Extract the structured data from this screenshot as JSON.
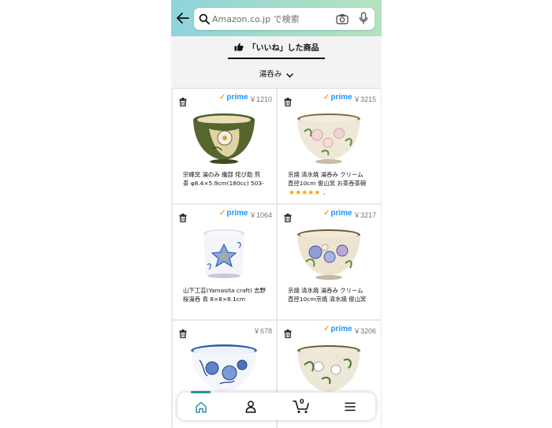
{
  "search": {
    "placeholder": "Amazon.co.jp で検索"
  },
  "tab": {
    "label": "「いいね」した商品"
  },
  "filter": {
    "label": "湯呑み"
  },
  "prime_label": "prime",
  "products": [
    {
      "prime": true,
      "price": "￥1210",
      "title_lines": [
        "宗峰窯 湯のみ 織部 侘び助 煎",
        "茶 φ8.4×5.9cm(180cc) 503-"
      ],
      "rating": null
    },
    {
      "prime": true,
      "price": "￥3215",
      "title_lines": [
        "京焼 清水焼 湯呑み クリーム",
        "直径10cm 俊山窯 お茶呑茶碗"
      ],
      "rating": 5
    },
    {
      "prime": true,
      "price": "￥1064",
      "title_lines": [
        "山下工芸(Yamasita craft) 志野",
        "桜湯呑 青 8×8×8.1cm"
      ],
      "rating": null
    },
    {
      "prime": true,
      "price": "￥3217",
      "title_lines": [
        "京焼 清水焼 湯呑み クリーム",
        "直径10cm京焼 清水焼 俊山窯"
      ],
      "rating": null
    },
    {
      "prime": false,
      "price": "￥678",
      "title_lines": [],
      "rating": null
    },
    {
      "prime": true,
      "price": "￥3206",
      "title_lines": [],
      "rating": null
    }
  ],
  "rating_display": "★★★★★",
  "cart": {
    "count": "0"
  },
  "colors": {
    "prime_blue": "#1a98ff",
    "accent_teal": "#2a8fa0",
    "star": "#f6a400"
  },
  "icons": [
    "back-arrow-icon",
    "search-icon",
    "camera-icon",
    "mic-icon",
    "thumbs-up-icon",
    "chevron-down-icon",
    "trash-icon",
    "home-icon",
    "account-icon",
    "cart-icon",
    "menu-icon"
  ]
}
